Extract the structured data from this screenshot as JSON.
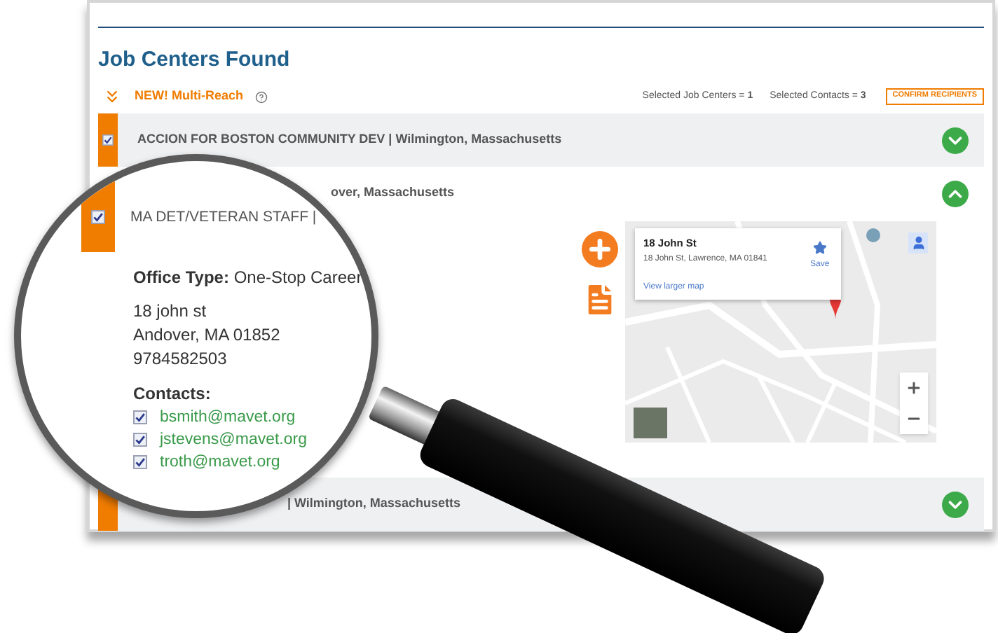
{
  "heading": "Job Centers Found",
  "toolbar": {
    "feature_label": "NEW! Multi-Reach",
    "selected_job_centers": "Selected Job Centers = **1**",
    "selected_contacts": "Selected Contacts = **3**",
    "confirm_button": "CONFIRM RECIPIENTS"
  },
  "results": [
    {
      "title": "ACCION FOR BOSTON COMMUNITY DEV | Wilmington, Massachusetts",
      "checkbox": {
        "checked": true
      },
      "expanded": false
    },
    {
      "title": "over, Massachusetts",
      "expanded": true
    },
    {
      "title": "| Wilmington, Massachusetts",
      "expanded": false
    }
  ],
  "map": {
    "card_title": "18 John St",
    "card_address": "18 John St, Lawrence, MA 01841",
    "card_link": "View larger map",
    "save": "Save"
  },
  "magnifier": {
    "title": "MA DET/VETERAN STAFF |",
    "checked": true,
    "office_type_label": "Office Type:",
    "office_type": "One-Stop Career",
    "address_lines": [
      "18 john st",
      "Andover, MA 01852"
    ],
    "phone": "9784582503",
    "contacts_label": "Contacts:",
    "contacts": [
      {
        "email": "bsmith@mavet.org",
        "checked": true
      },
      {
        "email": "jstevens@mavet.org",
        "checked": true
      },
      {
        "email": "troth@mavet.org",
        "checked": true
      }
    ]
  }
}
